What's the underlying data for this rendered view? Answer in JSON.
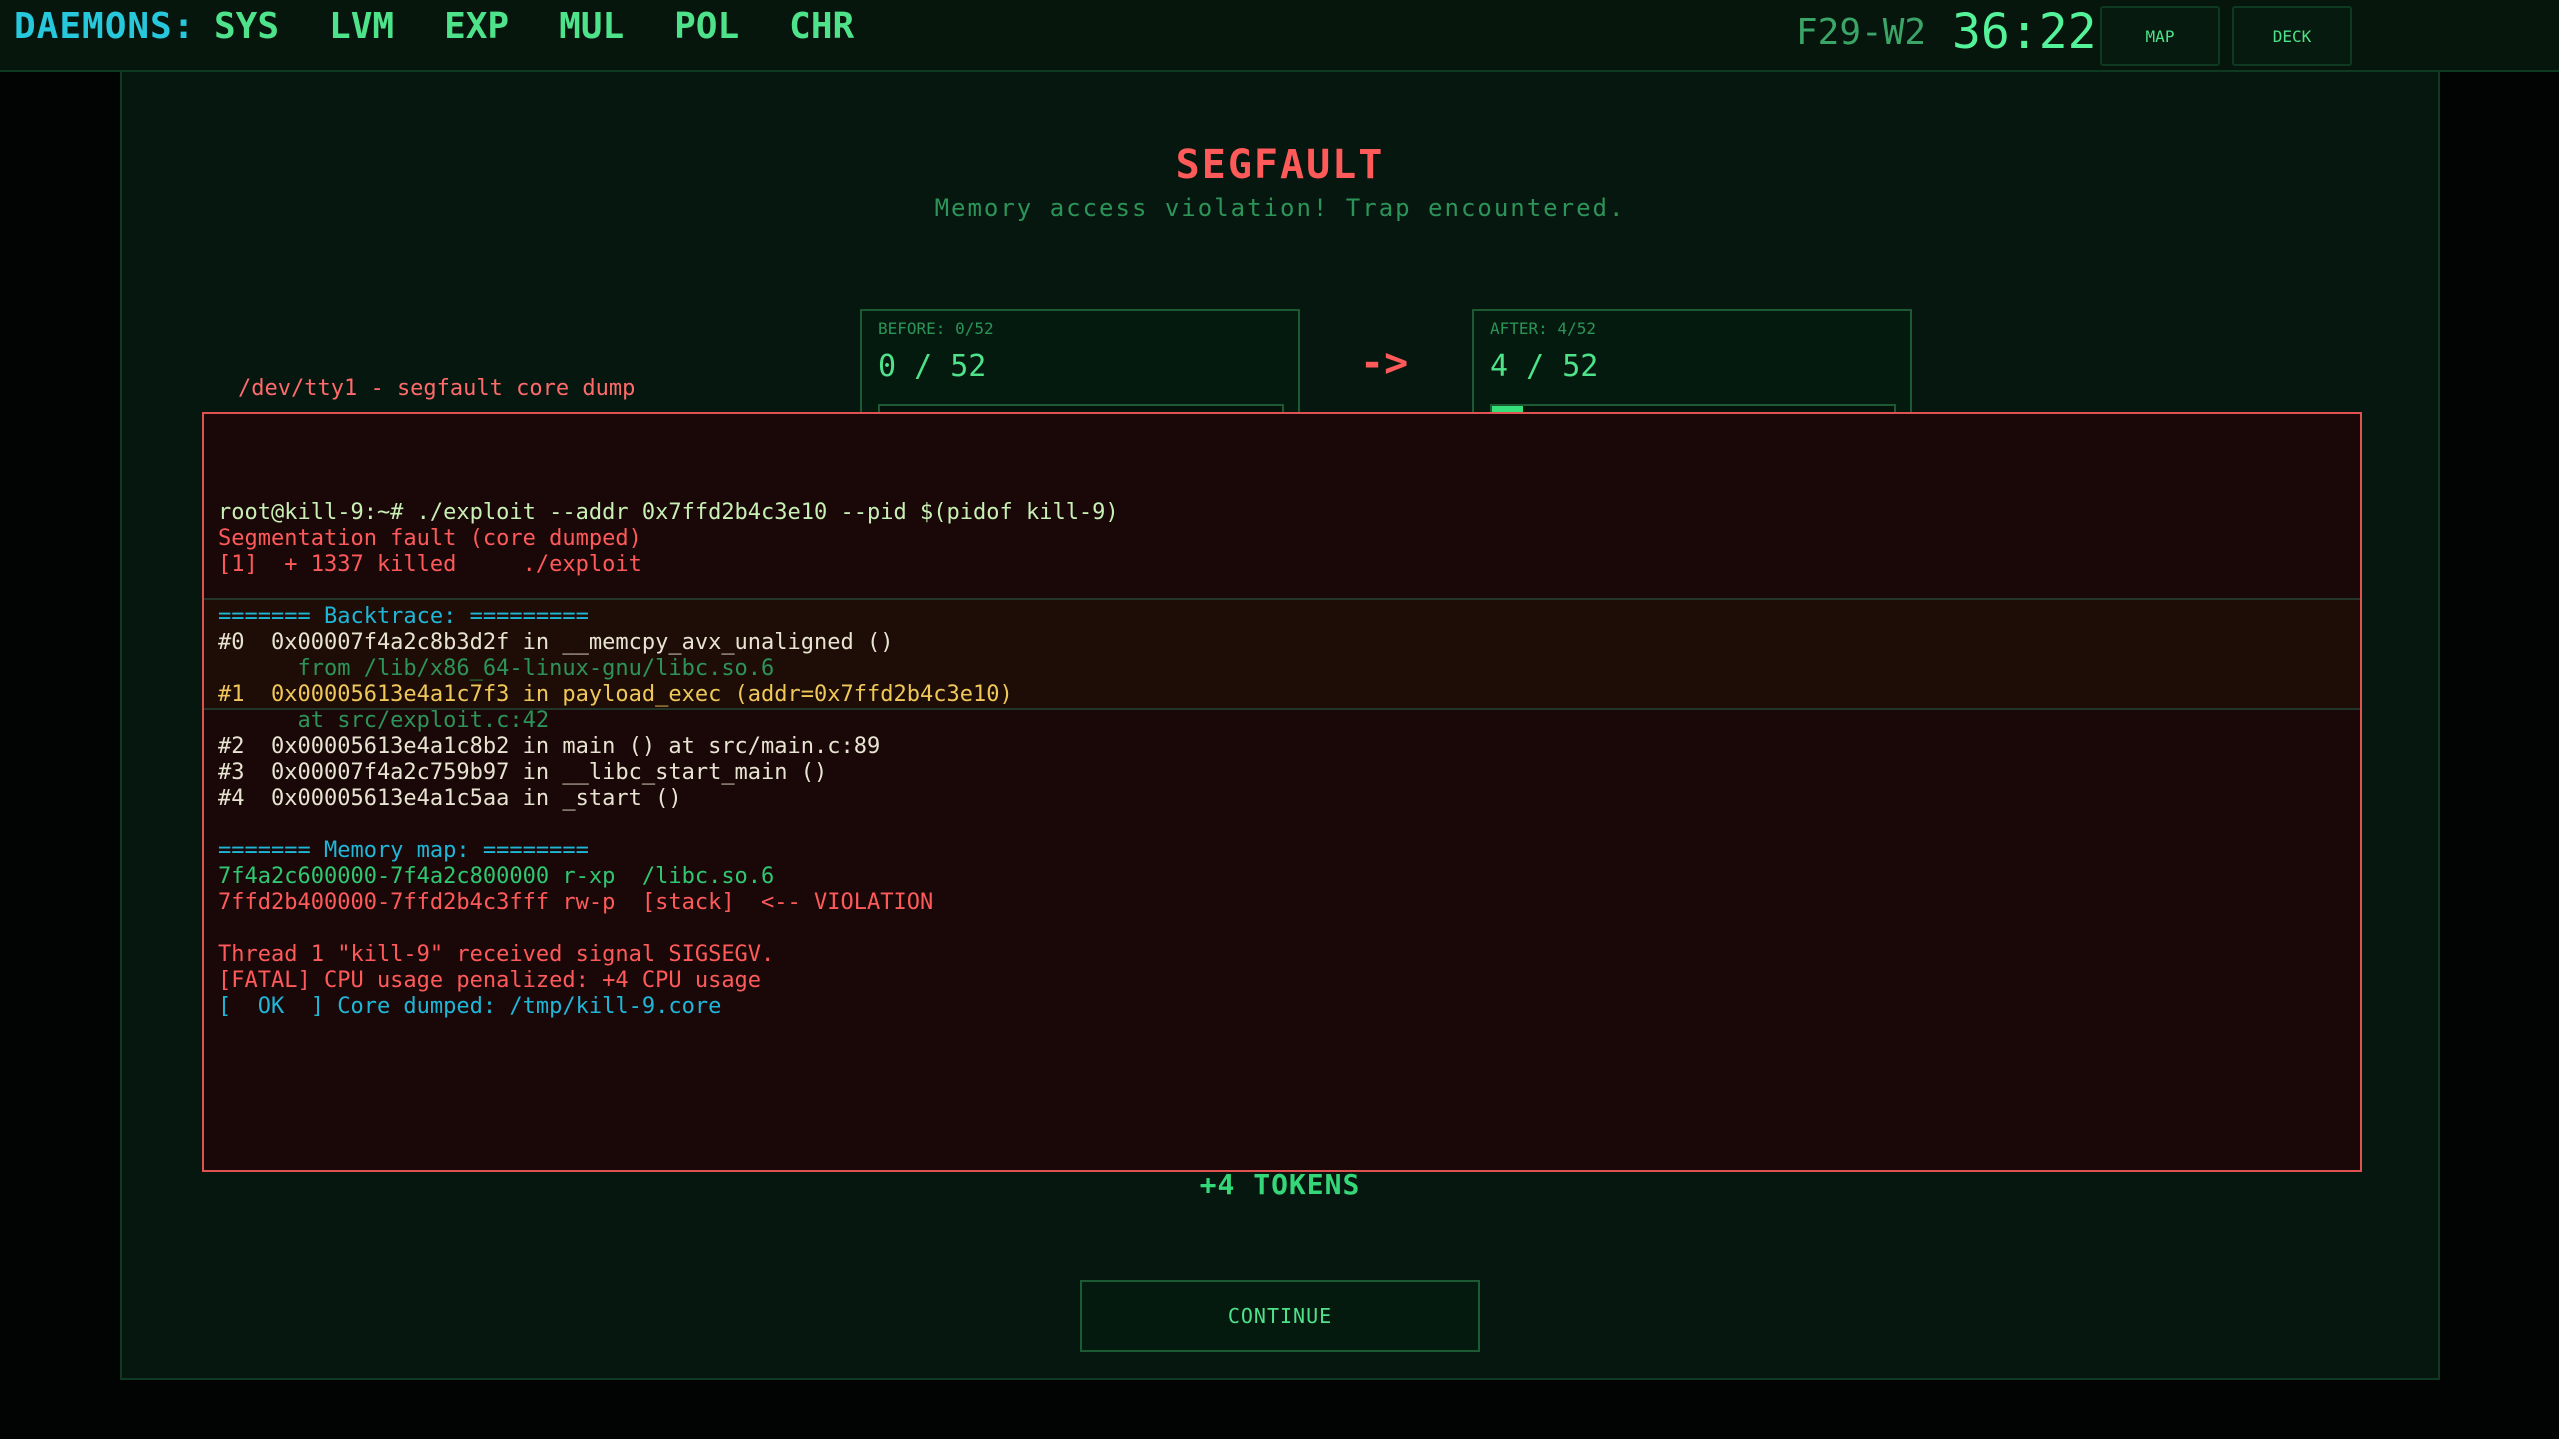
{
  "topbar": {
    "label": "DAEMONS:",
    "tabs": [
      "SYS",
      "LVM",
      "EXP",
      "MUL",
      "POL",
      "CHR"
    ],
    "cycle": "F29-W2",
    "timer": "36:22",
    "map_label": "MAP",
    "deck_label": "DECK"
  },
  "result": {
    "title": "SEGFAULT",
    "subtitle": "Memory access violation! Trap encountered."
  },
  "stats": {
    "before_label": "BEFORE: 0/52",
    "before_value": "0 / 52",
    "before_fraction": 0.0,
    "arrow": "->",
    "after_label": "AFTER: 4/52",
    "after_value": "4 / 52",
    "after_fraction": 0.077
  },
  "terminal": {
    "title": "/dev/tty1 - segfault core dump",
    "lines": [
      {
        "text": "root@kill-9:~# ./exploit --addr 0x7ffd2b4c3e10 --pid $(pidof kill-9)",
        "style": "prompt"
      },
      {
        "text": "Segmentation fault (core dumped)",
        "style": "red"
      },
      {
        "text": "[1]  + 1337 killed     ./exploit",
        "style": "red"
      },
      {
        "text": "",
        "style": "white"
      },
      {
        "text": "======= Backtrace: =========",
        "style": "cyan"
      },
      {
        "text": "#0  0x00007f4a2c8b3d2f in __memcpy_avx_unaligned ()",
        "style": "white"
      },
      {
        "text": "      from /lib/x86_64-linux-gnu/libc.so.6",
        "style": "dim"
      },
      {
        "text": "#1  0x00005613e4a1c7f3 in payload_exec (addr=0x7ffd2b4c3e10)",
        "style": "yellow"
      },
      {
        "text": "      at src/exploit.c:42",
        "style": "dim"
      },
      {
        "text": "#2  0x00005613e4a1c8b2 in main () at src/main.c:89",
        "style": "white"
      },
      {
        "text": "#3  0x00007f4a2c759b97 in __libc_start_main ()",
        "style": "white"
      },
      {
        "text": "#4  0x00005613e4a1c5aa in _start ()",
        "style": "white"
      },
      {
        "text": "",
        "style": "white"
      },
      {
        "text": "======= Memory map: ========",
        "style": "cyan"
      },
      {
        "text": "7f4a2c600000-7f4a2c800000 r-xp  /libc.so.6",
        "style": "green"
      },
      {
        "text": "7ffd2b400000-7ffd2b4c3fff rw-p  [stack]  <-- VIOLATION",
        "style": "red"
      },
      {
        "text": "",
        "style": "white"
      },
      {
        "text": "Thread 1 \"kill-9\" received signal SIGSEGV.",
        "style": "red"
      },
      {
        "text": "[FATAL] CPU usage penalized: +4 CPU usage",
        "style": "red"
      },
      {
        "text": "[  OK  ] Core dumped: /tmp/kill-9.core",
        "style": "ok"
      }
    ]
  },
  "reward": "+4 TOKENS",
  "continue_label": "CONTINUE"
}
